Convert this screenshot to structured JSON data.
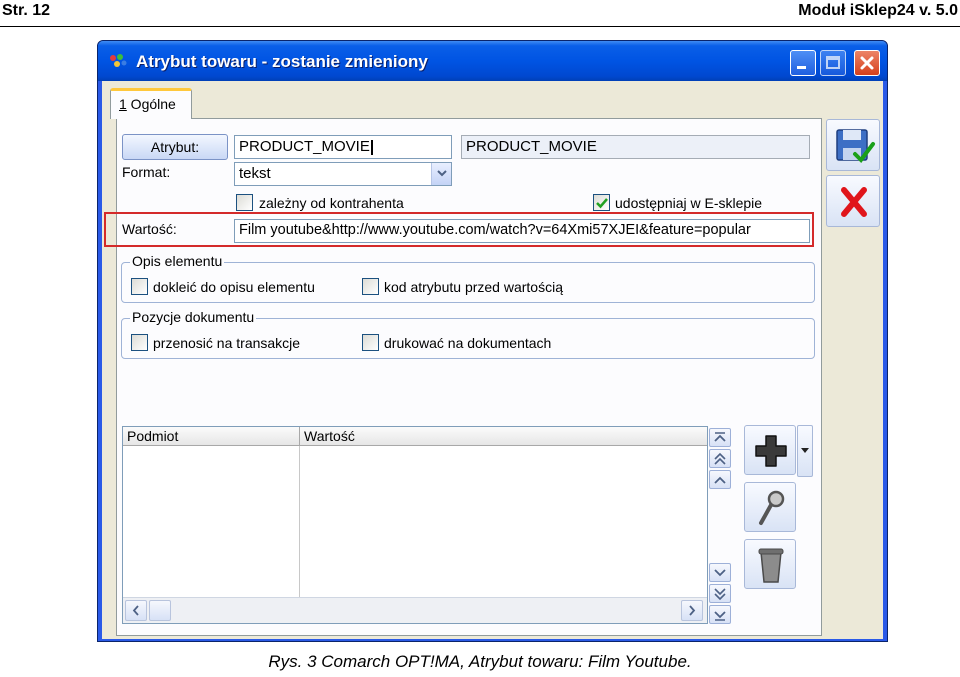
{
  "doc": {
    "page": "Str. 12",
    "module": "Moduł iSklep24 v. 5.0",
    "caption": "Rys. 3 Comarch OPT!MA, Atrybut towaru: Film Youtube."
  },
  "window": {
    "title": "Atrybut towaru - zostanie zmieniony"
  },
  "tabs": [
    {
      "hotkey": "1",
      "label": " Ogólne"
    }
  ],
  "form": {
    "atrybut_button": "Atrybut:",
    "atrybut_code": "PRODUCT_MOVIE",
    "atrybut_name": "PRODUCT_MOVIE",
    "format_label": "Format:",
    "format_value": "tekst",
    "zalezny_label": "zależny od kontrahenta",
    "zalezny_checked": false,
    "udostepniaj_label": "udostępniaj w E-sklepie",
    "udostepniaj_checked": true,
    "wartosc_label": "Wartość:",
    "wartosc_value": "Film youtube&http://www.youtube.com/watch?v=64Xmi57XJEI&feature=popular"
  },
  "opis": {
    "title": "Opis elementu",
    "dokleic_label": "dokleić do opisu elementu",
    "kod_label": "kod atrybutu przed wartością"
  },
  "pozycje": {
    "title": "Pozycje dokumentu",
    "przenosic_label": "przenosić na transakcje",
    "drukowac_label": "drukować na dokumentach"
  },
  "grid": {
    "columns": [
      "Podmiot",
      "Wartość"
    ],
    "rows": []
  },
  "colors": {
    "titlebar": "#0054e3",
    "highlight": "#d42a2a",
    "close_red": "#d6401c"
  }
}
